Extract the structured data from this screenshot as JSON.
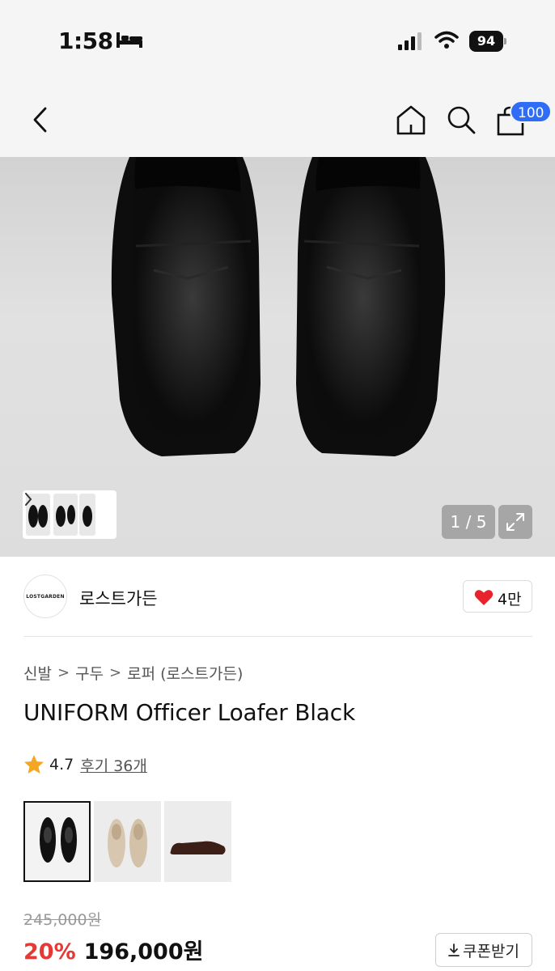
{
  "status_bar": {
    "time": "1:58",
    "battery": "94",
    "icons": [
      "bed-icon",
      "signal-icon",
      "wifi-icon",
      "battery-icon"
    ]
  },
  "nav": {
    "icons": [
      "back-icon",
      "home-icon",
      "search-icon",
      "bag-icon"
    ],
    "cart_badge": "100",
    "accent_color": "#2f6df6"
  },
  "gallery": {
    "counter": "1 / 5",
    "icons": [
      "chevron-right-icon",
      "expand-icon"
    ]
  },
  "brand": {
    "logo_text": "LOSTGARDEN",
    "name": "로스트가든",
    "like_count": "4만",
    "icons": [
      "heart-icon"
    ],
    "heart_color": "#e8232b"
  },
  "breadcrumb": {
    "items": [
      "신발",
      "구두",
      "로퍼 (로스트가든)"
    ],
    "separator": ">"
  },
  "product": {
    "title": "UNIFORM Officer Loafer Black",
    "rating": "4.7",
    "review_link": "후기 36개",
    "star_color": "#f5a623"
  },
  "color_options": [
    {
      "name": "black",
      "selected": true
    },
    {
      "name": "beige",
      "selected": false
    },
    {
      "name": "brown",
      "selected": false
    }
  ],
  "price": {
    "original": "245,000원",
    "discount": "20%",
    "final": "196,000원",
    "discount_color": "#e53935",
    "coupon_label": "쿠폰받기",
    "icons": [
      "download-icon"
    ]
  }
}
